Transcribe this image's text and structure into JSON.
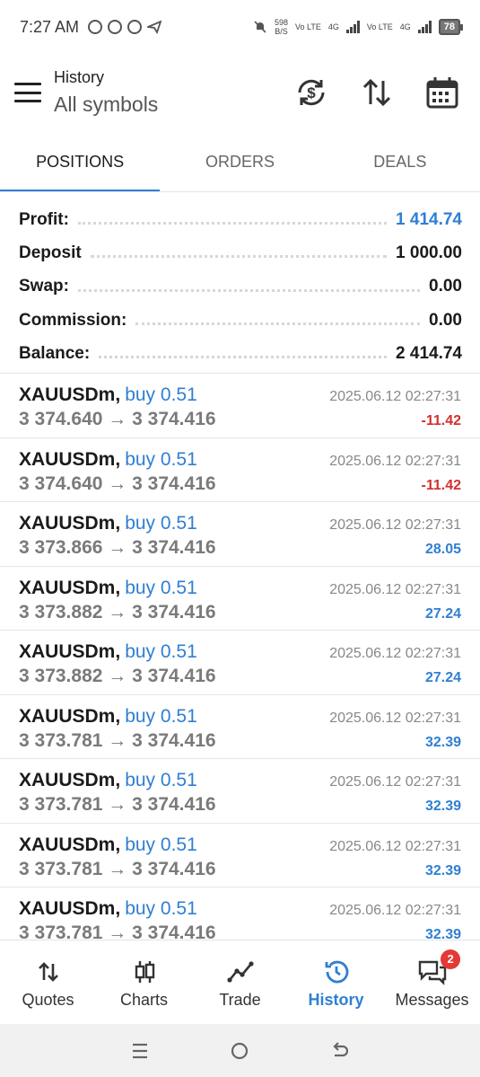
{
  "status_bar": {
    "time": "7:27 AM",
    "speed_value": "598",
    "speed_unit": "B/S",
    "network1": "Vo LTE",
    "network1_gen": "4G",
    "network2": "Vo LTE",
    "network2_gen": "4G",
    "battery": "78"
  },
  "header": {
    "title": "History",
    "subtitle": "All symbols"
  },
  "tabs": [
    {
      "label": "POSITIONS",
      "active": true
    },
    {
      "label": "ORDERS",
      "active": false
    },
    {
      "label": "DEALS",
      "active": false
    }
  ],
  "summary": [
    {
      "label": "Profit:",
      "value": "1 414.74",
      "accent": true
    },
    {
      "label": "Deposit",
      "value": "1 000.00",
      "accent": false
    },
    {
      "label": "Swap:",
      "value": "0.00",
      "accent": false
    },
    {
      "label": "Commission:",
      "value": "0.00",
      "accent": false
    },
    {
      "label": "Balance:",
      "value": "2 414.74",
      "accent": false
    }
  ],
  "deals": [
    {
      "symbol": "XAUUSDm",
      "direction": "buy 0.51",
      "time": "2025.06.12 02:27:31",
      "open": "3 374.640",
      "close": "3 374.416",
      "profit": "-11.42",
      "positive": false
    },
    {
      "symbol": "XAUUSDm",
      "direction": "buy 0.51",
      "time": "2025.06.12 02:27:31",
      "open": "3 374.640",
      "close": "3 374.416",
      "profit": "-11.42",
      "positive": false
    },
    {
      "symbol": "XAUUSDm",
      "direction": "buy 0.51",
      "time": "2025.06.12 02:27:31",
      "open": "3 373.866",
      "close": "3 374.416",
      "profit": "28.05",
      "positive": true
    },
    {
      "symbol": "XAUUSDm",
      "direction": "buy 0.51",
      "time": "2025.06.12 02:27:31",
      "open": "3 373.882",
      "close": "3 374.416",
      "profit": "27.24",
      "positive": true
    },
    {
      "symbol": "XAUUSDm",
      "direction": "buy 0.51",
      "time": "2025.06.12 02:27:31",
      "open": "3 373.882",
      "close": "3 374.416",
      "profit": "27.24",
      "positive": true
    },
    {
      "symbol": "XAUUSDm",
      "direction": "buy 0.51",
      "time": "2025.06.12 02:27:31",
      "open": "3 373.781",
      "close": "3 374.416",
      "profit": "32.39",
      "positive": true
    },
    {
      "symbol": "XAUUSDm",
      "direction": "buy 0.51",
      "time": "2025.06.12 02:27:31",
      "open": "3 373.781",
      "close": "3 374.416",
      "profit": "32.39",
      "positive": true
    },
    {
      "symbol": "XAUUSDm",
      "direction": "buy 0.51",
      "time": "2025.06.12 02:27:31",
      "open": "3 373.781",
      "close": "3 374.416",
      "profit": "32.39",
      "positive": true
    },
    {
      "symbol": "XAUUSDm",
      "direction": "buy 0.51",
      "time": "2025.06.12 02:27:31",
      "open": "3 373.781",
      "close": "3 374.416",
      "profit": "32.39",
      "positive": true
    }
  ],
  "arrow": "→",
  "bottom_nav": [
    {
      "label": "Quotes",
      "icon": "quotes-icon",
      "active": false
    },
    {
      "label": "Charts",
      "icon": "charts-icon",
      "active": false
    },
    {
      "label": "Trade",
      "icon": "trade-icon",
      "active": false
    },
    {
      "label": "History",
      "icon": "history-icon",
      "active": true
    },
    {
      "label": "Messages",
      "icon": "messages-icon",
      "active": false,
      "badge": "2"
    }
  ],
  "colors": {
    "accent": "#2f7fd3",
    "negative": "#d32f2f",
    "badge": "#e53935"
  }
}
